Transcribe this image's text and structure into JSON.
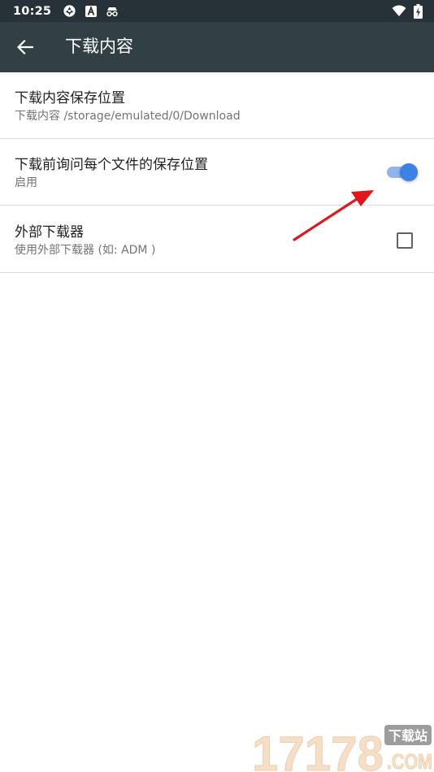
{
  "status_bar": {
    "time": "10:25",
    "left_icons": [
      "sync-icon",
      "a-badge-icon",
      "incognito-icon"
    ],
    "right_icons": [
      "wifi-icon",
      "battery-charging-icon"
    ]
  },
  "toolbar": {
    "back_icon": "arrow-back-icon",
    "title": "下载内容"
  },
  "preferences": [
    {
      "title": "下载内容保存位置",
      "summary": "下载内容 /storage/emulated/0/Download"
    },
    {
      "title": "下载前询问每个文件的保存位置",
      "summary": "启用",
      "control": "switch",
      "checked": true
    },
    {
      "title": "外部下载器",
      "summary": "使用外部下载器 (如: ADM )",
      "control": "checkbox",
      "checked": false
    }
  ],
  "watermark": {
    "number": "17178",
    "badge": "下载站",
    "domain": ".COM"
  },
  "colors": {
    "status_bar": "#273238",
    "toolbar": "#323f45",
    "accent": "#3b82e8",
    "annotation_arrow": "#e0161b"
  }
}
